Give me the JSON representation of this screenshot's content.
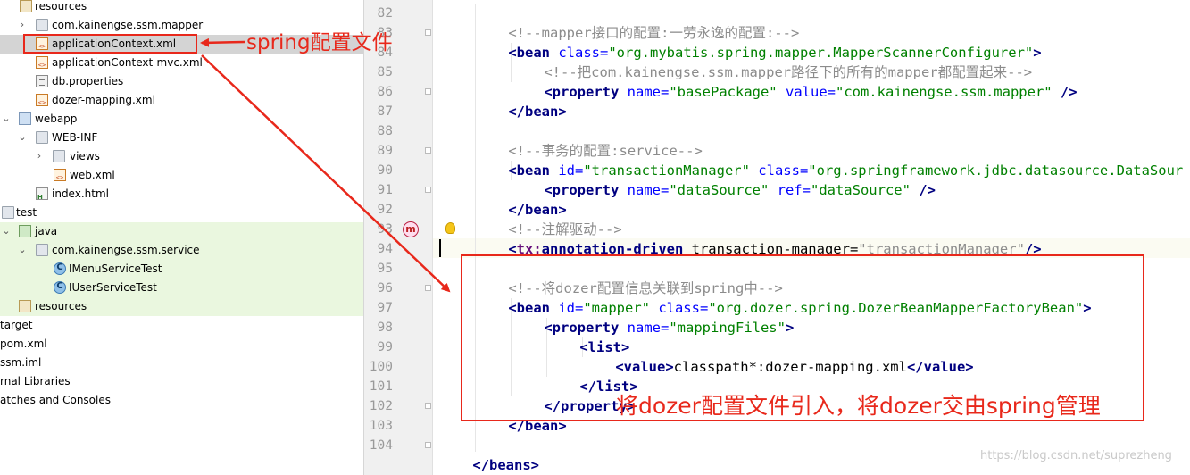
{
  "tree": {
    "items": [
      {
        "label": "resources",
        "icon": "resources-folder-icon"
      },
      {
        "label": "com.kainengse.ssm.mapper",
        "icon": "package-folder-icon"
      },
      {
        "label": "applicationContext.xml",
        "icon": "xml-file-icon"
      },
      {
        "label": "applicationContext-mvc.xml",
        "icon": "xml-file-icon"
      },
      {
        "label": "db.properties",
        "icon": "properties-file-icon"
      },
      {
        "label": "dozer-mapping.xml",
        "icon": "xml-file-icon"
      },
      {
        "label": "webapp",
        "icon": "web-folder-icon"
      },
      {
        "label": "WEB-INF",
        "icon": "folder-icon"
      },
      {
        "label": "views",
        "icon": "folder-icon"
      },
      {
        "label": "web.xml",
        "icon": "xml-file-icon"
      },
      {
        "label": "index.html",
        "icon": "html-file-icon"
      },
      {
        "label": "test",
        "icon": "folder-icon"
      },
      {
        "label": "java",
        "icon": "test-source-folder-icon"
      },
      {
        "label": "com.kainengse.ssm.service",
        "icon": "package-folder-icon"
      },
      {
        "label": "IMenuServiceTest",
        "icon": "class-icon"
      },
      {
        "label": "IUserServiceTest",
        "icon": "class-icon"
      },
      {
        "label": "resources",
        "icon": "resources-folder-icon"
      },
      {
        "label": "target",
        "icon": "folder-icon"
      },
      {
        "label": "pom.xml",
        "icon": "xml-file-icon"
      },
      {
        "label": "ssm.iml",
        "icon": "module-file-icon"
      },
      {
        "label": "rnal Libraries",
        "icon": "libraries-icon"
      },
      {
        "label": "atches and Consoles",
        "icon": "scratches-icon"
      }
    ]
  },
  "editor": {
    "line_numbers": [
      "82",
      "83",
      "84",
      "85",
      "86",
      "87",
      "88",
      "89",
      "90",
      "91",
      "92",
      "93",
      "94",
      "95",
      "96",
      "97",
      "98",
      "99",
      "100",
      "101",
      "102",
      "103",
      "104"
    ],
    "code": {
      "l82_comment": "<!--mapper接口的配置:一劳永逸的配置:-->",
      "l83_open": "<",
      "l83_tag": "bean",
      "l83_attr": " class=",
      "l83_val": "\"org.mybatis.spring.mapper.MapperScannerConfigurer\"",
      "l83_close": ">",
      "l84_comment": "<!--把com.kainengse.ssm.mapper路径下的所有的mapper都配置起来-->",
      "l85_open": "<",
      "l85_tag": "property",
      "l85_attr1": " name=",
      "l85_val1": "\"basePackage\"",
      "l85_attr2": " value=",
      "l85_val2": "\"com.kainengse.ssm.mapper\"",
      "l85_close": " />",
      "l86_text": "</bean>",
      "l88_comment": "<!--事务的配置:service-->",
      "l89_open": "<",
      "l89_tag": "bean",
      "l89_attr1": " id=",
      "l89_val1": "\"transactionManager\"",
      "l89_attr2": " class=",
      "l89_val2": "\"org.springframework.jdbc.datasource.DataSour",
      "l90_open": "<",
      "l90_tag": "property",
      "l90_attr1": " name=",
      "l90_val1": "\"dataSource\"",
      "l90_attr2": " ref=",
      "l90_val2": "\"dataSource\"",
      "l90_close": " />",
      "l91_text": "</bean>",
      "l92_comment": "<!--注解驱动-->",
      "l93_open": "<",
      "l93_ns": "tx:",
      "l93_tag": "annotation-driven",
      "l93_attr": " transaction-manager=",
      "l93_val": "\"transactionManager\"",
      "l93_close": "/>",
      "l95_comment": "<!--将dozer配置信息关联到spring中-->",
      "l96_open": "<",
      "l96_tag": "bean",
      "l96_attr1": " id=",
      "l96_val1": "\"mapper\"",
      "l96_attr2": " class=",
      "l96_val2": "\"org.dozer.spring.DozerBeanMapperFactoryBean\"",
      "l96_close": ">",
      "l97_open": "<",
      "l97_tag": "property",
      "l97_attr": " name=",
      "l97_val": "\"mappingFiles\"",
      "l97_close": ">",
      "l98_text": "<list>",
      "l99_open": "<value>",
      "l99_txt": "classpath*:dozer-mapping.xml",
      "l99_close": "</value>",
      "l100_text": "</list>",
      "l101_text": "</property>",
      "l102_text": "</bean>",
      "l104_text": "</beans>"
    },
    "gutter_icons": {
      "bean": "m"
    }
  },
  "annotations": {
    "spring_config": "spring配置文件",
    "dozer_note": "将dozer配置文件引入，将dozer交由spring管理"
  },
  "watermark": "https://blog.csdn.net/suprezheng",
  "colors": {
    "highlight_red": "#e8281b",
    "tag": "#000080",
    "attribute": "#0000ff",
    "value": "#008000",
    "comment": "#8c8c8c",
    "namespace": "#660e7a",
    "tree_test_bg": "#eaf7df",
    "tree_selected_bg": "#d4d4d4"
  }
}
